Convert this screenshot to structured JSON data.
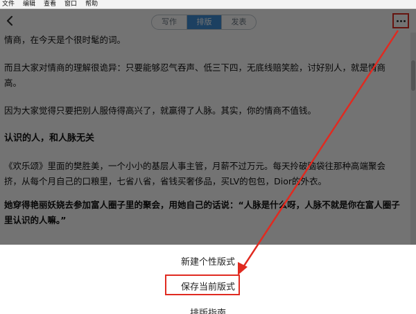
{
  "menubar": {
    "items": [
      "文件",
      "编辑",
      "查看",
      "窗口",
      "帮助"
    ]
  },
  "topbar": {
    "back_icon": "chevron-left-icon",
    "tabs": [
      {
        "label": "写作",
        "active": false
      },
      {
        "label": "排版",
        "active": true
      },
      {
        "label": "发表",
        "active": false
      }
    ],
    "more_icon": "ellipsis-icon"
  },
  "article": {
    "p1": "情商，在今天是个很时髦的词。",
    "p2": "而且大家对情商的理解很诡异：只要能够忍气吞声、低三下四，无底线赔笑脸，讨好别人，就是情商高。",
    "p3": "因为大家觉得只要把别人服侍得高兴了，就赢得了人脉。其实，你的情商不值钱。",
    "heading": "认识的人，和人脉无关",
    "p4": "《欢乐颂》里面的樊胜美，一个小小的基层人事主管，月薪不过万元。每天拎破脑袋往那种高端聚会挤，从每个月自己的口粮里，七省八省，省钱买奢侈品，买LV的包包，Dior的外衣。",
    "p5": "她穿得艳丽妖娆去参加富人圈子里的聚会，用她自己的话说：“人脉是什么呀，人脉不就是你在富人圈子里认识的人嘛。”"
  },
  "sheet": {
    "new_style": "新建个性版式",
    "save_style": "保存当前版式",
    "guide": "排版指南"
  },
  "colors": {
    "accent": "#3e8fd8",
    "highlight": "#e02a20",
    "overlay": "rgba(0,0,0,0.55)"
  }
}
